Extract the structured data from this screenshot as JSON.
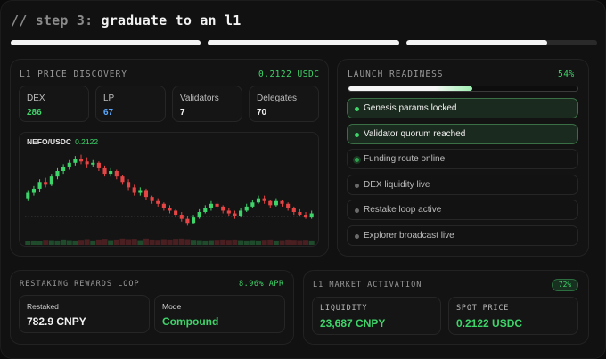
{
  "header": {
    "title_prefix": "// step 3:",
    "title_main": "graduate to an l1",
    "step_progress": [
      1,
      1,
      0.74
    ]
  },
  "price_discovery": {
    "label": "L1 PRICE DISCOVERY",
    "price": "0.2122 USDC",
    "stats": [
      {
        "label": "DEX",
        "value": "286",
        "color": "#3fd46a"
      },
      {
        "label": "LP",
        "value": "67",
        "color": "#5aa8ff"
      },
      {
        "label": "Validators",
        "value": "7",
        "color": "#f2f2f2"
      },
      {
        "label": "Delegates",
        "value": "70",
        "color": "#f2f2f2"
      }
    ],
    "chart_pair": "NEFO/USDC",
    "chart_price": "0.2122"
  },
  "chart_data": {
    "type": "candlestick",
    "title": "NEFO/USDC",
    "up_color": "#3fd46a",
    "down_color": "#e64545",
    "reference_line": "dotted",
    "candles": [
      [
        0.4,
        0.44,
        0.38,
        0.46,
        0.2
      ],
      [
        0.44,
        0.47,
        0.42,
        0.49,
        0.3
      ],
      [
        0.47,
        0.52,
        0.45,
        0.54,
        0.25
      ],
      [
        0.52,
        0.5,
        0.48,
        0.55,
        0.4
      ],
      [
        0.5,
        0.56,
        0.49,
        0.58,
        0.35
      ],
      [
        0.56,
        0.6,
        0.54,
        0.62,
        0.3
      ],
      [
        0.6,
        0.63,
        0.58,
        0.65,
        0.45
      ],
      [
        0.63,
        0.66,
        0.61,
        0.68,
        0.35
      ],
      [
        0.66,
        0.69,
        0.64,
        0.71,
        0.3
      ],
      [
        0.69,
        0.67,
        0.65,
        0.72,
        0.4
      ],
      [
        0.67,
        0.65,
        0.62,
        0.7,
        0.5
      ],
      [
        0.65,
        0.66,
        0.63,
        0.68,
        0.3
      ],
      [
        0.66,
        0.62,
        0.6,
        0.67,
        0.45
      ],
      [
        0.62,
        0.58,
        0.56,
        0.64,
        0.55
      ],
      [
        0.58,
        0.6,
        0.56,
        0.62,
        0.35
      ],
      [
        0.6,
        0.56,
        0.54,
        0.61,
        0.45
      ],
      [
        0.56,
        0.52,
        0.5,
        0.57,
        0.6
      ],
      [
        0.52,
        0.48,
        0.46,
        0.54,
        0.5
      ],
      [
        0.48,
        0.44,
        0.42,
        0.5,
        0.55
      ],
      [
        0.44,
        0.46,
        0.42,
        0.48,
        0.35
      ],
      [
        0.46,
        0.41,
        0.39,
        0.47,
        0.6
      ],
      [
        0.41,
        0.38,
        0.36,
        0.42,
        0.45
      ],
      [
        0.38,
        0.36,
        0.34,
        0.4,
        0.4
      ],
      [
        0.36,
        0.33,
        0.31,
        0.37,
        0.5
      ],
      [
        0.33,
        0.31,
        0.29,
        0.35,
        0.45
      ],
      [
        0.31,
        0.28,
        0.26,
        0.32,
        0.55
      ],
      [
        0.28,
        0.25,
        0.23,
        0.3,
        0.6
      ],
      [
        0.25,
        0.22,
        0.2,
        0.27,
        0.5
      ],
      [
        0.22,
        0.26,
        0.21,
        0.28,
        0.4
      ],
      [
        0.26,
        0.3,
        0.25,
        0.32,
        0.35
      ],
      [
        0.3,
        0.33,
        0.29,
        0.35,
        0.3
      ],
      [
        0.33,
        0.36,
        0.31,
        0.38,
        0.35
      ],
      [
        0.36,
        0.34,
        0.32,
        0.38,
        0.4
      ],
      [
        0.34,
        0.31,
        0.29,
        0.35,
        0.45
      ],
      [
        0.31,
        0.29,
        0.27,
        0.33,
        0.4
      ],
      [
        0.29,
        0.27,
        0.25,
        0.31,
        0.45
      ],
      [
        0.27,
        0.31,
        0.26,
        0.33,
        0.35
      ],
      [
        0.31,
        0.34,
        0.3,
        0.36,
        0.3
      ],
      [
        0.34,
        0.37,
        0.33,
        0.39,
        0.35
      ],
      [
        0.37,
        0.4,
        0.36,
        0.42,
        0.3
      ],
      [
        0.4,
        0.38,
        0.36,
        0.42,
        0.4
      ],
      [
        0.38,
        0.35,
        0.33,
        0.39,
        0.45
      ],
      [
        0.35,
        0.38,
        0.34,
        0.4,
        0.3
      ],
      [
        0.38,
        0.36,
        0.34,
        0.39,
        0.35
      ],
      [
        0.36,
        0.33,
        0.31,
        0.37,
        0.45
      ],
      [
        0.33,
        0.3,
        0.28,
        0.34,
        0.4
      ],
      [
        0.3,
        0.28,
        0.27,
        0.32,
        0.35
      ],
      [
        0.28,
        0.26,
        0.25,
        0.3,
        0.4
      ],
      [
        0.26,
        0.29,
        0.25,
        0.31,
        0.3
      ]
    ]
  },
  "launch_readiness": {
    "label": "LAUNCH READINESS",
    "percent": "54%",
    "progress": 0.54,
    "tasks": [
      {
        "label": "Genesis params locked",
        "state": "done"
      },
      {
        "label": "Validator quorum reached",
        "state": "done"
      },
      {
        "label": "Funding route online",
        "state": "active"
      },
      {
        "label": "DEX liquidity live",
        "state": "pending"
      },
      {
        "label": "Restake loop active",
        "state": "pending"
      },
      {
        "label": "Explorer broadcast live",
        "state": "pending"
      }
    ]
  },
  "restaking": {
    "label": "RESTAKING REWARDS LOOP",
    "apr": "8.96% APR",
    "restaked_label": "Restaked",
    "restaked_value": "782.9 CNPY",
    "mode_label": "Mode",
    "mode_value": "Compound"
  },
  "market_activation": {
    "label": "L1 MARKET ACTIVATION",
    "badge": "72%",
    "liquidity_label": "LIQUIDITY",
    "liquidity_value": "23,687 CNPY",
    "spot_label": "SPOT PRICE",
    "spot_value": "0.2122 USDC"
  }
}
